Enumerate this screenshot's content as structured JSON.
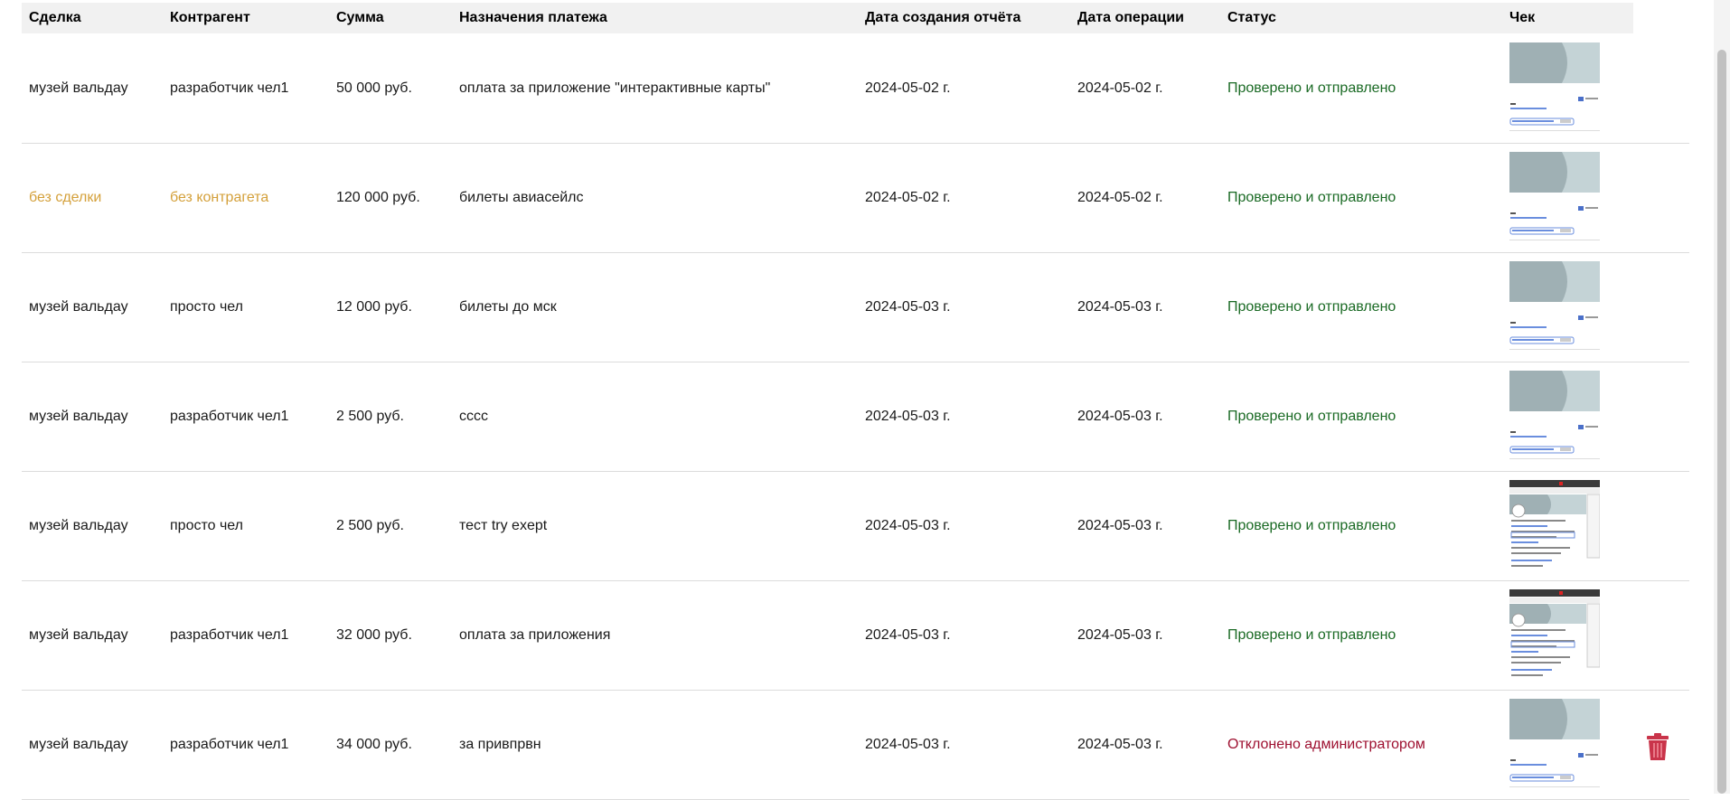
{
  "table": {
    "headers": {
      "deal": "Сделка",
      "counterparty": "Контрагент",
      "amount": "Сумма",
      "purpose": "Назначения платежа",
      "report_date": "Дата создания отчёта",
      "operation_date": "Дата операции",
      "status": "Статус",
      "receipt": "Чек"
    },
    "rows": [
      {
        "deal": "музей вальдау",
        "counterparty": "разработчик чел1",
        "amount": "50 000 руб.",
        "purpose": "оплата за приложение \"интерактивные карты\"",
        "report_date": "2024-05-02 г.",
        "operation_date": "2024-05-02 г.",
        "status": "Проверено и отправлено"
      },
      {
        "deal": "без сделки",
        "counterparty": "без контрагета",
        "amount": "120 000 руб.",
        "purpose": "билеты авиасейлс",
        "report_date": "2024-05-02 г.",
        "operation_date": "2024-05-02 г.",
        "status": "Проверено и отправлено"
      },
      {
        "deal": "музей вальдау",
        "counterparty": "просто чел",
        "amount": "12 000 руб.",
        "purpose": "билеты до мск",
        "report_date": "2024-05-03 г.",
        "operation_date": "2024-05-03 г.",
        "status": "Проверено и отправлено"
      },
      {
        "deal": "музей вальдау",
        "counterparty": "разработчик чел1",
        "amount": "2 500 руб.",
        "purpose": "сссс",
        "report_date": "2024-05-03 г.",
        "operation_date": "2024-05-03 г.",
        "status": "Проверено и отправлено"
      },
      {
        "deal": "музей вальдау",
        "counterparty": "просто чел",
        "amount": "2 500 руб.",
        "purpose": "тест try exept",
        "report_date": "2024-05-03 г.",
        "operation_date": "2024-05-03 г.",
        "status": "Проверено и отправлено"
      },
      {
        "deal": "музей вальдау",
        "counterparty": "разработчик чел1",
        "amount": "32 000 руб.",
        "purpose": "оплата за приложения",
        "report_date": "2024-05-03 г.",
        "operation_date": "2024-05-03 г.",
        "status": "Проверено и отправлено"
      },
      {
        "deal": "музей вальдау",
        "counterparty": "разработчик чел1",
        "amount": "34 000 руб.",
        "purpose": "за привпрвн",
        "report_date": "2024-05-03 г.",
        "operation_date": "2024-05-03 г.",
        "status": "Отклонено администратором"
      }
    ]
  },
  "colors": {
    "status_ok": "#1a6a24",
    "status_rejected": "#9e1030",
    "muted": "#d4a03a",
    "trash": "#c9344a"
  },
  "icons": {
    "receipt": "receipt-thumbnail",
    "delete": "trash-icon"
  }
}
